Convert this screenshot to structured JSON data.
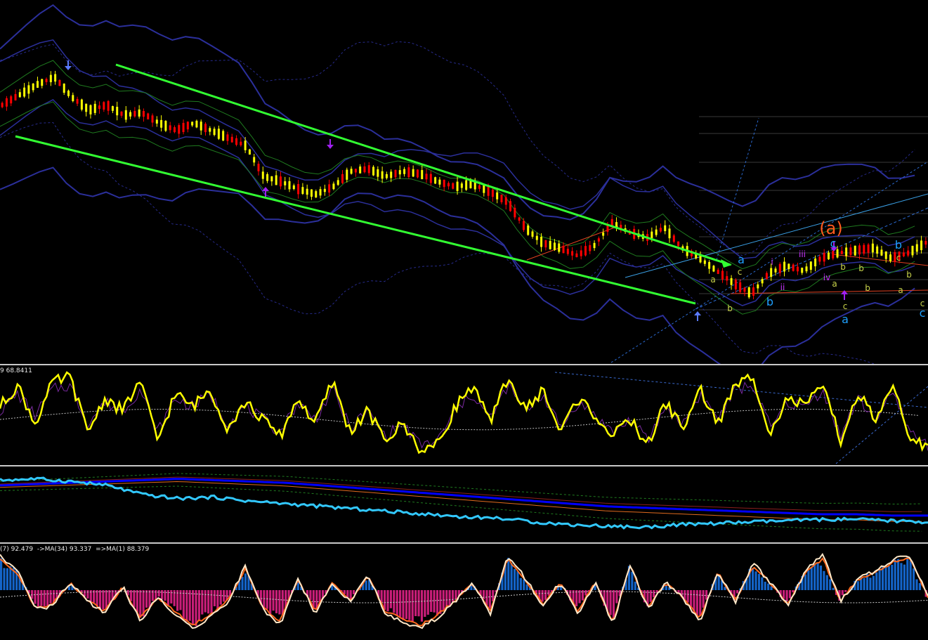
{
  "panes": {
    "oscillator": {
      "label": "9 68.8411"
    },
    "histogram": {
      "label": "(7) 92.479  ->MA(34) 93.337  =>MA(1) 88.379"
    }
  },
  "waves": [
    {
      "text": "(a)",
      "color": "#ff5a1e",
      "size": "big"
    },
    {
      "text": "a",
      "color": "#1ea0ff",
      "size": "normal"
    },
    {
      "text": "c",
      "color": "#1ea0ff",
      "size": "normal"
    },
    {
      "text": "b",
      "color": "#1ea0ff",
      "size": "normal"
    },
    {
      "text": "b",
      "color": "#1ea0ff",
      "size": "normal"
    },
    {
      "text": "a",
      "color": "#1ea0ff",
      "size": "normal"
    },
    {
      "text": "c",
      "color": "#1ea0ff",
      "size": "normal"
    },
    {
      "text": "i",
      "color": "#c832ff",
      "size": "small"
    },
    {
      "text": "ii",
      "color": "#c832ff",
      "size": "small"
    },
    {
      "text": "iii",
      "color": "#c832ff",
      "size": "small"
    },
    {
      "text": "iv",
      "color": "#c832ff",
      "size": "small"
    },
    {
      "text": "a",
      "color": "#c8d24a",
      "size": "small"
    },
    {
      "text": "b",
      "color": "#c8d24a",
      "size": "small"
    },
    {
      "text": "c",
      "color": "#c8d24a",
      "size": "small"
    },
    {
      "text": "a",
      "color": "#c8d24a",
      "size": "small"
    },
    {
      "text": "b",
      "color": "#c8d24a",
      "size": "small"
    },
    {
      "text": "b",
      "color": "#c8d24a",
      "size": "small"
    },
    {
      "text": "c",
      "color": "#c8d24a",
      "size": "small"
    },
    {
      "text": "c",
      "color": "#c8d24a",
      "size": "small"
    },
    {
      "text": "b",
      "color": "#c8d24a",
      "size": "small"
    },
    {
      "text": "a",
      "color": "#c8d24a",
      "size": "small"
    },
    {
      "text": "c",
      "color": "#c8d24a",
      "size": "small"
    },
    {
      "text": "b",
      "color": "#c8d24a",
      "size": "small"
    }
  ],
  "chart_data": [
    {
      "type": "candlestick",
      "title": "",
      "direction": "downtrend channel then sideways consolidation",
      "colors": {
        "up": "#ffff00",
        "down": "#ff0000",
        "channel": "#32ff32",
        "envelopes": "#2b2f9a",
        "ma": "#1f7a1f"
      },
      "close": [
        1.2,
        1.24,
        1.28,
        1.31,
        1.23,
        1.18,
        1.2,
        1.16,
        1.17,
        1.13,
        1.1,
        1.13,
        1.1,
        1.07,
        1.04,
        0.92,
        0.9,
        0.87,
        0.85,
        0.88,
        0.94,
        0.95,
        0.92,
        0.94,
        0.93,
        0.9,
        0.88,
        0.89,
        0.86,
        0.82,
        0.72,
        0.66,
        0.64,
        0.61,
        0.65,
        0.74,
        0.7,
        0.68,
        0.72,
        0.64,
        0.6,
        0.55,
        0.5,
        0.46,
        0.54,
        0.57,
        0.55,
        0.6,
        0.62,
        0.63,
        0.64,
        0.6,
        0.62,
        0.66
      ]
    },
    {
      "type": "line",
      "title": "",
      "series": [
        {
          "color": "#ffff00",
          "values": [
            60,
            85,
            40,
            88,
            95,
            30,
            70,
            55,
            90,
            20,
            75,
            60,
            80,
            35,
            65,
            45,
            25,
            70,
            40,
            90,
            30,
            55,
            20,
            40,
            10,
            15,
            60,
            85,
            40,
            95,
            55,
            80,
            30,
            70,
            50,
            25,
            45,
            15,
            65,
            35,
            80,
            40,
            85,
            95,
            30,
            70,
            60,
            85,
            20,
            75,
            45,
            80,
            25,
            10
          ]
        },
        {
          "color": "#7a2aa0",
          "values": [
            55,
            75,
            50,
            80,
            85,
            40,
            65,
            55,
            80,
            30,
            70,
            60,
            75,
            40,
            60,
            45,
            30,
            65,
            45,
            80,
            35,
            55,
            25,
            40,
            15,
            20,
            55,
            75,
            45,
            85,
            55,
            75,
            35,
            65,
            50,
            30,
            45,
            20,
            60,
            40,
            75,
            45,
            80,
            85,
            35,
            65,
            60,
            80,
            25,
            70,
            45,
            75,
            30,
            15
          ]
        }
      ]
    },
    {
      "type": "line",
      "title": "",
      "series": [
        {
          "color": "#32c8ff",
          "values": [
            96,
            97,
            95,
            92,
            85,
            82,
            83,
            80,
            78,
            76,
            74,
            72,
            70,
            68,
            67,
            64,
            62,
            61,
            60,
            62,
            63,
            64,
            65,
            66,
            66,
            65,
            64
          ]
        },
        {
          "color": "#0000ff",
          "values": [
            92,
            93,
            94,
            95,
            96,
            97,
            96,
            95,
            94,
            92,
            90,
            88,
            86,
            84,
            82,
            80,
            78,
            76,
            75,
            74,
            73,
            72,
            71,
            70,
            70,
            69,
            69
          ]
        }
      ]
    },
    {
      "type": "bar",
      "title": "",
      "series": [
        {
          "color": "#1464c8",
          "values": [
            0.9,
            0.5,
            0,
            0,
            0.2,
            0,
            0,
            0.1,
            0,
            0,
            0,
            0,
            0,
            0,
            0.6,
            0,
            0,
            0.3,
            0,
            0.2,
            0,
            0.4,
            0,
            0,
            0,
            0,
            0,
            0.2,
            0,
            0.9,
            0.3,
            0,
            0.2,
            0,
            0.2,
            0,
            0.7,
            0,
            0.2,
            0,
            0,
            0.5,
            0,
            0.7,
            0.2,
            0,
            0.5,
            0.9,
            0,
            0.3,
            0.5,
            0.8,
            0.9,
            0.4
          ]
        },
        {
          "color": "#c81e78",
          "values": [
            0,
            0,
            -0.5,
            -0.4,
            0,
            -0.3,
            -0.6,
            0,
            -0.8,
            -0.2,
            -0.6,
            -1.0,
            -0.7,
            -0.3,
            0,
            -0.5,
            -0.9,
            0,
            -0.6,
            0,
            -0.3,
            0,
            -0.6,
            -0.8,
            -1.0,
            -0.7,
            -0.3,
            0,
            -0.6,
            0,
            0,
            -0.4,
            0,
            -0.6,
            0,
            -0.9,
            0,
            -0.5,
            0,
            -0.2,
            -0.8,
            0,
            -0.3,
            0,
            0,
            -0.4,
            0,
            0,
            -0.3,
            0,
            0,
            0,
            0,
            -0.6
          ]
        }
      ]
    }
  ]
}
